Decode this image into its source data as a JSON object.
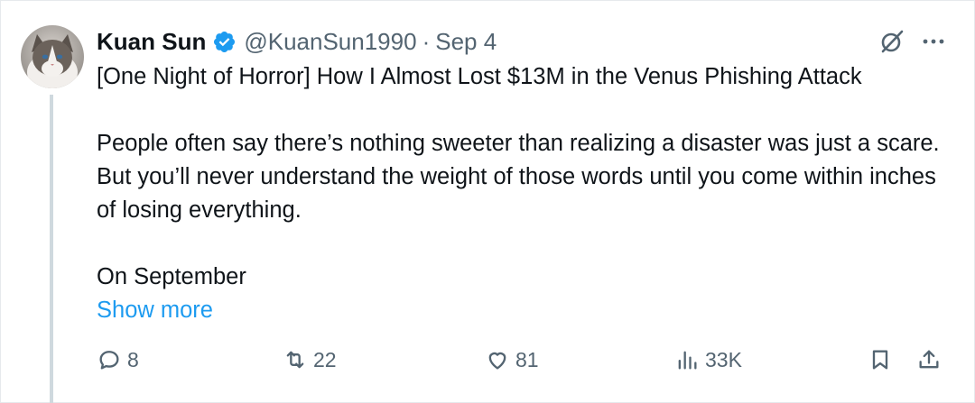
{
  "author": {
    "name": "Kuan Sun",
    "handle": "@KuanSun1990",
    "separator": "·",
    "date": "Sep 4",
    "verified": true
  },
  "post": {
    "title_line": "[One Night of Horror] How I Almost Lost $13M in the Venus Phishing Attack",
    "paragraph_1": "People often say there’s nothing sweeter than realizing a disaster was just a scare. But you’ll never understand the weight of those words until you come within inches of losing everything.",
    "paragraph_2": "On September",
    "show_more": "Show more"
  },
  "actions": {
    "replies": "8",
    "reposts": "22",
    "likes": "81",
    "views": "33K"
  },
  "colors": {
    "text": "#0f1419",
    "secondary": "#536471",
    "accent": "#1d9bf0",
    "thread_line": "#cfd9de"
  },
  "icons": [
    "verified-badge-icon",
    "grok-icon",
    "more-icon",
    "reply-icon",
    "repost-icon",
    "like-icon",
    "views-icon",
    "bookmark-icon",
    "share-icon"
  ]
}
